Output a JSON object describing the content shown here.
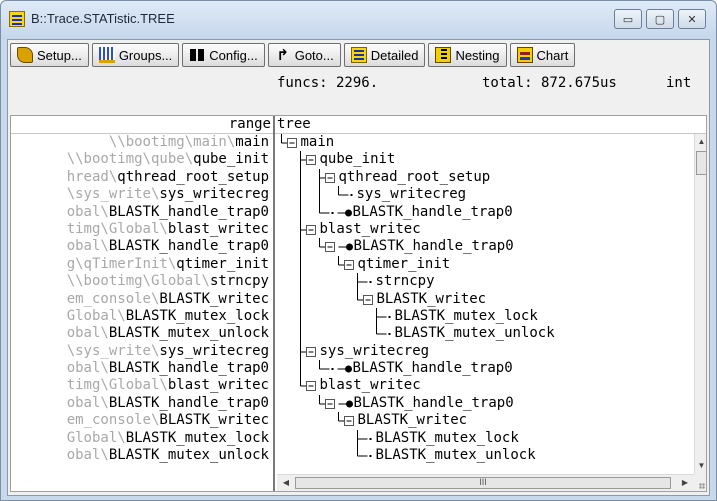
{
  "window": {
    "title": "B::Trace.STATistic.TREE",
    "controls": {
      "minimize": "▭",
      "maximize": "▢",
      "close": "✕"
    }
  },
  "toolbar": {
    "buttons": [
      {
        "label": "Setup...",
        "icon": "wrench-icon"
      },
      {
        "label": "Groups...",
        "icon": "groups-icon"
      },
      {
        "label": "Config...",
        "icon": "config-icon"
      },
      {
        "label": "Goto...",
        "icon": "goto-icon"
      },
      {
        "label": "Detailed",
        "icon": "detailed-icon"
      },
      {
        "label": "Nesting",
        "icon": "nesting-icon"
      },
      {
        "label": "Chart",
        "icon": "chart-icon"
      }
    ]
  },
  "stats": {
    "funcs": "funcs: 2296.",
    "total": "total: 872.675us",
    "extra": "int"
  },
  "columns": {
    "range": "range",
    "tree": "tree"
  },
  "range_rows": [
    {
      "prefix": "\\\\bootimg\\main\\",
      "name": "main"
    },
    {
      "prefix": "\\\\bootimg\\qube\\",
      "name": "qube_init"
    },
    {
      "prefix": "hread\\",
      "name": "qthread_root_setup"
    },
    {
      "prefix": "\\sys_write\\",
      "name": "sys_writecreg"
    },
    {
      "prefix": "obal\\",
      "name": "BLASTK_handle_trap0"
    },
    {
      "prefix": "timg\\Global\\",
      "name": "blast_writec"
    },
    {
      "prefix": "obal\\",
      "name": "BLASTK_handle_trap0"
    },
    {
      "prefix": "g\\qTimerInit\\",
      "name": "qtimer_init"
    },
    {
      "prefix": "\\\\bootimg\\Global\\",
      "name": "strncpy"
    },
    {
      "prefix": "em_console\\",
      "name": "BLASTK_writec"
    },
    {
      "prefix": "Global\\",
      "name": "BLASTK_mutex_lock"
    },
    {
      "prefix": "obal\\",
      "name": "BLASTK_mutex_unlock"
    },
    {
      "prefix": "\\sys_write\\",
      "name": "sys_writecreg"
    },
    {
      "prefix": "obal\\",
      "name": "BLASTK_handle_trap0"
    },
    {
      "prefix": "timg\\Global\\",
      "name": "blast_writec"
    },
    {
      "prefix": "obal\\",
      "name": "BLASTK_handle_trap0"
    },
    {
      "prefix": "em_console\\",
      "name": "BLASTK_writec"
    },
    {
      "prefix": "Global\\",
      "name": "BLASTK_mutex_lock"
    },
    {
      "prefix": "obal\\",
      "name": "BLASTK_mutex_unlock"
    }
  ],
  "tree_rows": [
    {
      "depth": 0,
      "kind": "expanded",
      "last": false,
      "label": "main"
    },
    {
      "depth": 1,
      "kind": "expanded",
      "last": false,
      "label": "qube_init"
    },
    {
      "depth": 2,
      "kind": "expanded",
      "last": false,
      "label": "qthread_root_setup"
    },
    {
      "depth": 3,
      "kind": "leaf",
      "last": true,
      "label": "sys_writecreg"
    },
    {
      "depth": 2,
      "kind": "trap",
      "last": true,
      "label": "BLASTK_handle_trap0"
    },
    {
      "depth": 1,
      "kind": "expanded",
      "last": false,
      "label": "blast_writec"
    },
    {
      "depth": 2,
      "kind": "trap-expanded",
      "last": false,
      "label": "BLASTK_handle_trap0"
    },
    {
      "depth": 3,
      "kind": "expanded",
      "last": true,
      "label": "qtimer_init"
    },
    {
      "depth": 4,
      "kind": "leaf",
      "last": false,
      "label": "strncpy"
    },
    {
      "depth": 4,
      "kind": "expanded",
      "last": true,
      "label": "BLASTK_writec"
    },
    {
      "depth": 5,
      "kind": "leaf",
      "last": false,
      "label": "BLASTK_mutex_lock"
    },
    {
      "depth": 5,
      "kind": "leaf",
      "last": true,
      "label": "BLASTK_mutex_unlock"
    },
    {
      "depth": 1,
      "kind": "expanded",
      "last": false,
      "label": "sys_writecreg"
    },
    {
      "depth": 2,
      "kind": "trap",
      "last": true,
      "label": "BLASTK_handle_trap0"
    },
    {
      "depth": 1,
      "kind": "expanded",
      "last": false,
      "label": "blast_writec"
    },
    {
      "depth": 2,
      "kind": "trap-expanded",
      "last": true,
      "label": "BLASTK_handle_trap0"
    },
    {
      "depth": 3,
      "kind": "expanded",
      "last": true,
      "label": "BLASTK_writec"
    },
    {
      "depth": 4,
      "kind": "leaf",
      "last": false,
      "label": "BLASTK_mutex_lock"
    },
    {
      "depth": 4,
      "kind": "leaf",
      "last": true,
      "label": "BLASTK_mutex_unlock"
    }
  ],
  "scrollbars": {
    "up": "▲",
    "down": "▼",
    "left": "◀",
    "right": "▶",
    "thumb_grip": "III"
  }
}
